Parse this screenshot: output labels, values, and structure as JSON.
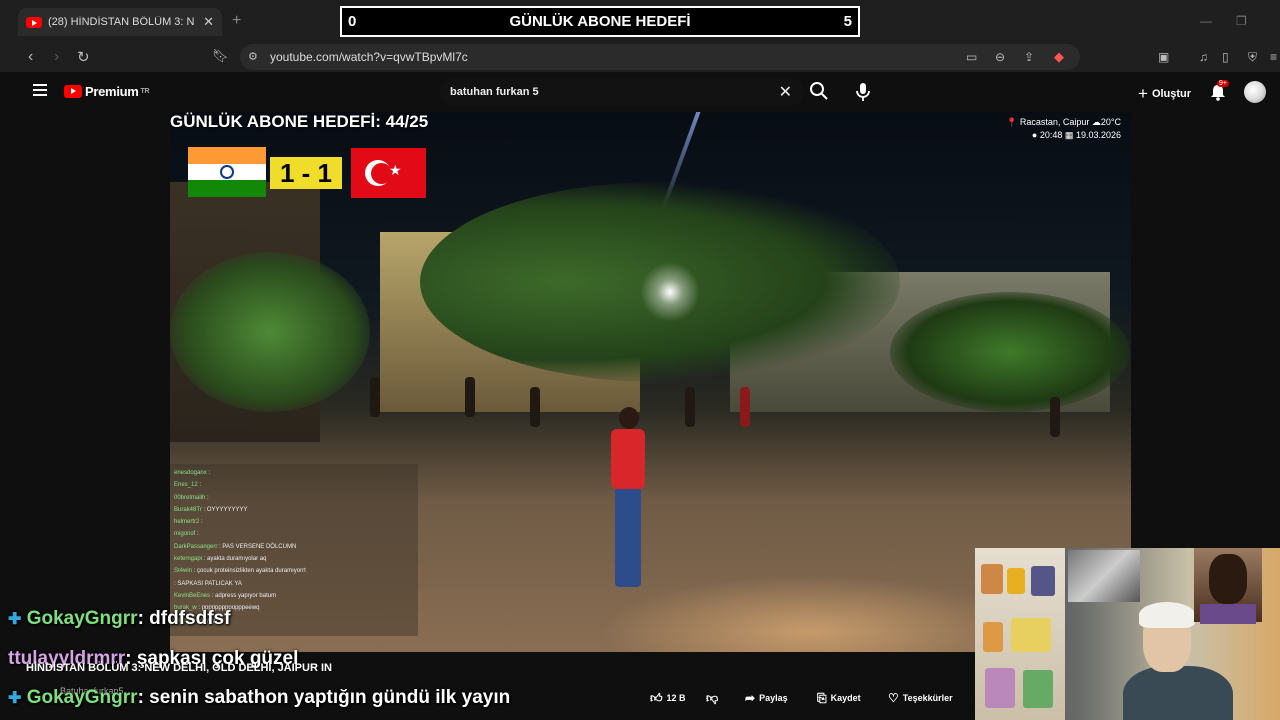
{
  "browser": {
    "tab_title": "(28) HİNDİSTAN BÖLÜM 3: N",
    "url": "youtube.com/watch?v=qvwTBpvMl7c"
  },
  "goal_bar": {
    "left": "0",
    "title": "GÜNLÜK ABONE HEDEFİ",
    "right": "5"
  },
  "youtube": {
    "logo": "Premium",
    "logo_region": "TR",
    "search_value": "batuhan furkan 5",
    "create_label": "Oluştur",
    "notifications_badge": "9+"
  },
  "video": {
    "goal_overlay": "GÜNLÜK ABONE HEDEFİ: 44/25",
    "score": "1 - 1",
    "location": "Racastan, Caipur",
    "temperature": "20°C",
    "time": "20:48",
    "date": "19.03.2026",
    "title": "HİNDİSTAN BÖLÜM 3: NEW DELHI, OLD DELHI, JAIPUR IN",
    "channel": "Batuhanfurkan5"
  },
  "stream_chat": [
    {
      "user": "enesdoganx",
      "msg": ""
    },
    {
      "user": "Enes_12",
      "msg": ""
    },
    {
      "user": "00bretmalih",
      "msg": ""
    },
    {
      "user": "Burak48Tr",
      "msg": "OYYYYYYYYY"
    },
    {
      "user": "helmertr2",
      "msg": ""
    },
    {
      "user": "migonof",
      "msg": ""
    },
    {
      "user": "DarkPassangerr",
      "msg": "PAS VERSENE DÖLCUMN"
    },
    {
      "user": "keterngapi",
      "msg": "ayakta duramıyolar aq"
    },
    {
      "user": "St4win",
      "msg": "çocuk proteinsizlikten ayakta duramıyorrt"
    },
    {
      "user": "",
      "msg": "SAPKASI PATLICAK YA"
    },
    {
      "user": "KevinBeEnes",
      "msg": "adpress yapıyor batum"
    },
    {
      "user": "burak_w",
      "msg": "pppppppppopppeewq"
    },
    {
      "user": "Yilmazz",
      "msg": "oyyyy"
    }
  ],
  "overlay_chat": [
    {
      "user": "GokayGngrr",
      "msg": "dfdfsdfsf"
    },
    {
      "user": "ttulayyldrmrr",
      "msg": "şapkası çok güzel"
    },
    {
      "user": "GokayGngrr",
      "msg": "senin sabathon yaptığın gündü ilk yayın"
    }
  ],
  "actions": {
    "like_count": "12 B",
    "share": "Paylaş",
    "save": "Kaydet",
    "thanks": "Teşekkürler"
  },
  "colors": {
    "youtube_red": "#ff0000",
    "score_yellow": "#f0dc2a",
    "india_saffron": "#ff9933",
    "india_green": "#138808",
    "turkey_red": "#e30a17"
  }
}
